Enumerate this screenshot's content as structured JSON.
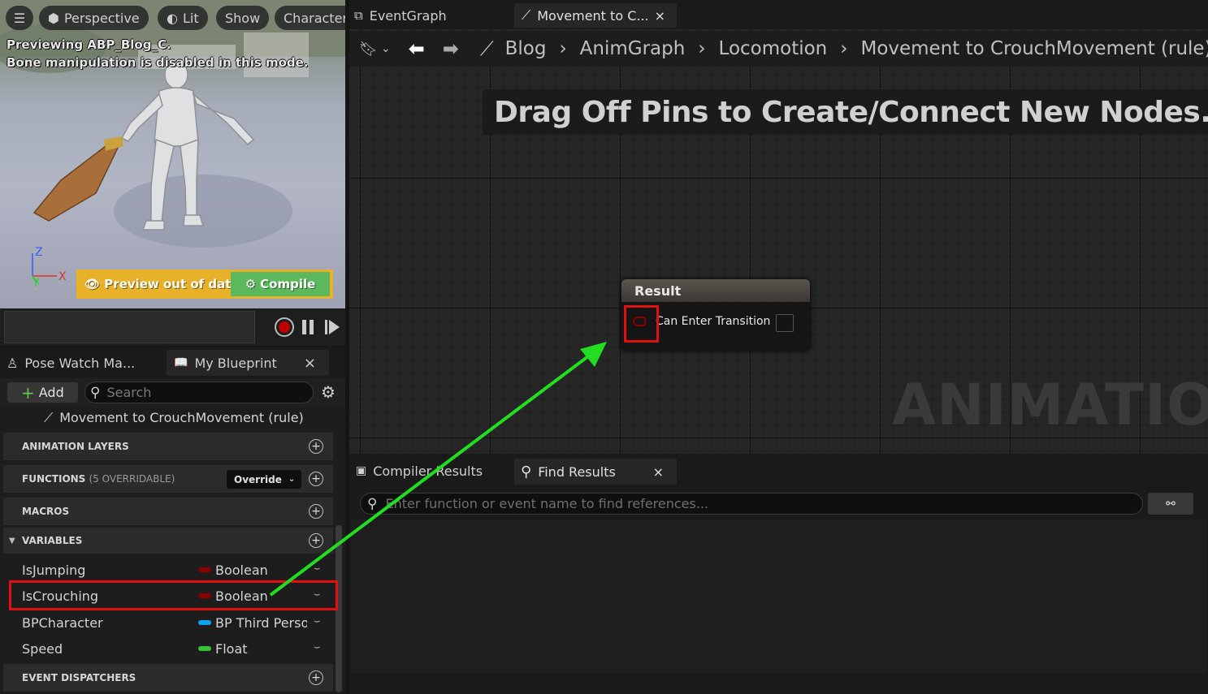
{
  "viewport": {
    "menu_icon": "hamburger-icon",
    "buttons": [
      "Perspective",
      "Lit",
      "Show",
      "Character"
    ],
    "preview_line1": "Previewing ABP_Blog_C.",
    "preview_line2": "Bone manipulation is disabled in this mode.",
    "axis": {
      "z": "Z",
      "y": "Y",
      "x": "X"
    },
    "warning": "Preview out of date",
    "compile": "Compile"
  },
  "left_tabs": [
    {
      "label": "Pose Watch Ma...",
      "icon": "pose-watch-icon"
    },
    {
      "label": "My Blueprint",
      "icon": "book-icon",
      "close": "×"
    }
  ],
  "toolbar": {
    "add": "Add",
    "search_placeholder": "Search"
  },
  "current_graph": "Movement to CrouchMovement (rule)",
  "categories": {
    "anim_layers": "ANIMATION LAYERS",
    "functions": "FUNCTIONS",
    "functions_note": "(5 OVERRIDABLE)",
    "override": "Override",
    "macros": "MACROS",
    "variables": "VARIABLES",
    "dispatchers": "EVENT DISPATCHERS"
  },
  "variables": [
    {
      "name": "IsJumping",
      "type": "Boolean",
      "color": "#8c0000"
    },
    {
      "name": "IsCrouching",
      "type": "Boolean",
      "color": "#8c0000"
    },
    {
      "name": "BPCharacter",
      "type": "BP Third Person Character",
      "color": "#0ca2f0"
    },
    {
      "name": "Speed",
      "type": "Float",
      "color": "#35c235"
    }
  ],
  "graph_tabs": [
    {
      "label": "EventGraph",
      "icon": "event-graph-icon"
    },
    {
      "label": "Movement to C...",
      "icon": "rule-icon",
      "close": "×"
    }
  ],
  "breadcrumb": [
    "Blog",
    "AnimGraph",
    "Locomotion",
    "Movement to CrouchMovement (rule)"
  ],
  "graph_hint": "Drag Off Pins to Create/Connect New Nodes.",
  "watermark": "ANIMATION",
  "node": {
    "title": "Result",
    "pin_label": "Can Enter Transition"
  },
  "bottom_tabs": [
    {
      "label": "Compiler Results",
      "icon": "compiler-icon"
    },
    {
      "label": "Find Results",
      "icon": "search-icon",
      "close": "×"
    }
  ],
  "find_placeholder": "Enter function or event name to find references...",
  "colors": {
    "highlight": "#e01010",
    "arrow": "#22dd22",
    "accent_warn": "#e7b12a",
    "compile": "#5cb85c"
  }
}
